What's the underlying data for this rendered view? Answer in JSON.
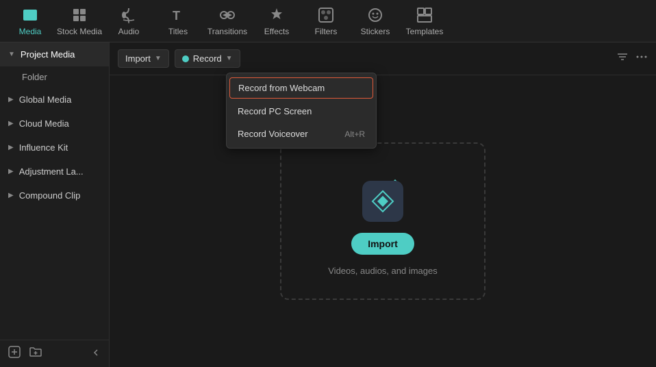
{
  "topNav": {
    "items": [
      {
        "id": "media",
        "label": "Media",
        "active": true
      },
      {
        "id": "stock-media",
        "label": "Stock Media",
        "active": false
      },
      {
        "id": "audio",
        "label": "Audio",
        "active": false
      },
      {
        "id": "titles",
        "label": "Titles",
        "active": false
      },
      {
        "id": "transitions",
        "label": "Transitions",
        "active": false
      },
      {
        "id": "effects",
        "label": "Effects",
        "active": false
      },
      {
        "id": "filters",
        "label": "Filters",
        "active": false
      },
      {
        "id": "stickers",
        "label": "Stickers",
        "active": false
      },
      {
        "id": "templates",
        "label": "Templates",
        "active": false
      }
    ]
  },
  "sidebar": {
    "items": [
      {
        "id": "project-media",
        "label": "Project Media",
        "active": true,
        "hasChevron": true,
        "chevronDown": true
      },
      {
        "id": "folder",
        "label": "Folder",
        "isSubItem": true
      },
      {
        "id": "global-media",
        "label": "Global Media",
        "hasChevron": true,
        "chevronRight": true
      },
      {
        "id": "cloud-media",
        "label": "Cloud Media",
        "hasChevron": true,
        "chevronRight": true
      },
      {
        "id": "influence-kit",
        "label": "Influence Kit",
        "hasChevron": true,
        "chevronRight": true
      },
      {
        "id": "adjustment-la",
        "label": "Adjustment La...",
        "hasChevron": true,
        "chevronRight": true
      },
      {
        "id": "compound-clip",
        "label": "Compound Clip",
        "hasChevron": true,
        "chevronRight": true
      }
    ],
    "bottomIcons": [
      "add-folder-icon",
      "collapse-icon"
    ]
  },
  "toolbar": {
    "importLabel": "Import",
    "recordLabel": "Record",
    "filterIcon": "filter-icon",
    "moreIcon": "more-icon"
  },
  "dropdown": {
    "items": [
      {
        "id": "record-webcam",
        "label": "Record from Webcam",
        "highlighted": true
      },
      {
        "id": "record-pc-screen",
        "label": "Record PC Screen",
        "shortcut": ""
      },
      {
        "id": "record-voiceover",
        "label": "Record Voiceover",
        "shortcut": "Alt+R"
      }
    ]
  },
  "dropZone": {
    "importLabel": "Import",
    "description": "Videos, audios, and images"
  }
}
